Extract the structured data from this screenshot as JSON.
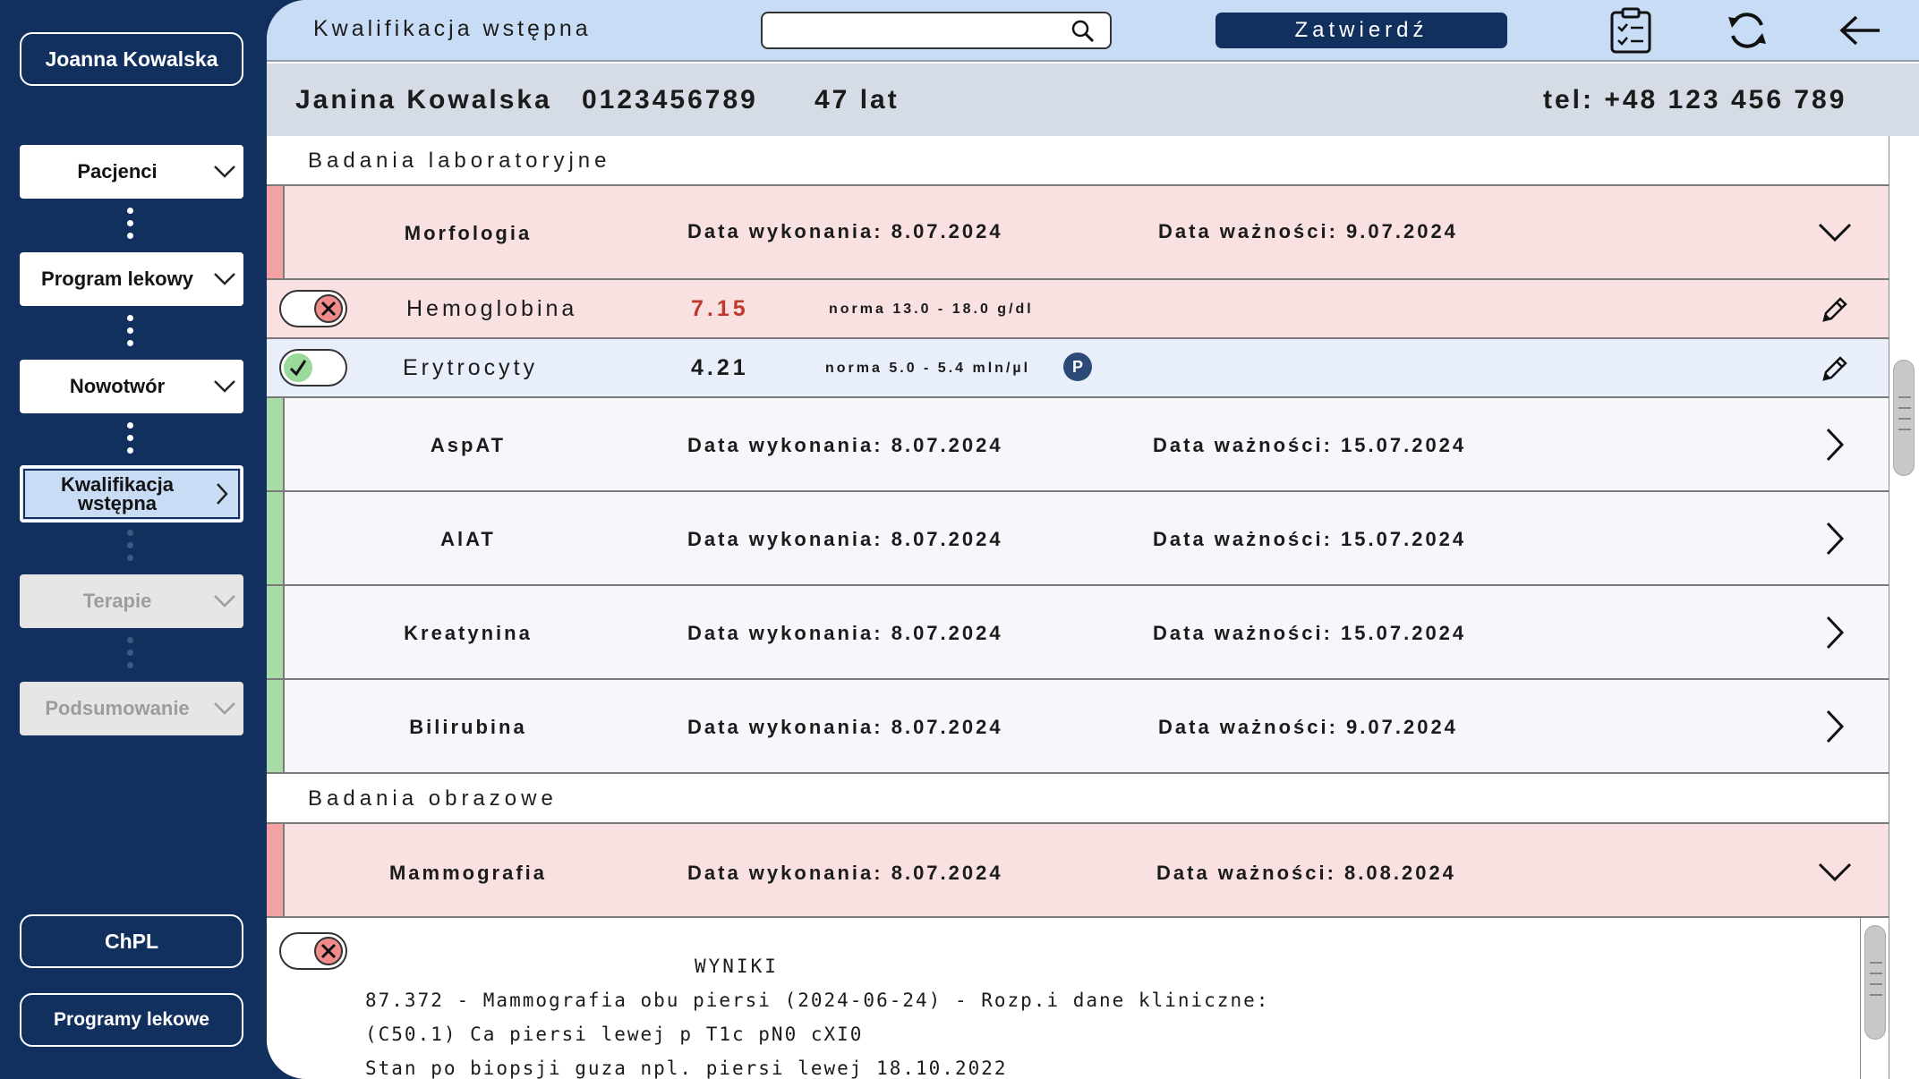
{
  "user": {
    "name": "Joanna Kowalska"
  },
  "steps": [
    {
      "label": "Pacjenci"
    },
    {
      "label": "Program lekowy"
    },
    {
      "label": "Nowotwór"
    },
    {
      "label": "Kwalifikacja wstępna"
    },
    {
      "label": "Terapie"
    },
    {
      "label": "Podsumowanie"
    }
  ],
  "bottom_links": {
    "chpl": "ChPL",
    "programs": "Programy lekowe"
  },
  "header": {
    "title": "Kwalifikacja wstępna",
    "search_value": "",
    "confirm_label": "Zatwierdź"
  },
  "patient": {
    "name": "Janina Kowalska",
    "id": "0123456789",
    "age": "47 lat",
    "phone": "tel: +48 123 456 789"
  },
  "lab": {
    "title": "Badania laboratoryjne",
    "tests": [
      {
        "name": "Morfologia",
        "performed": "Data wykonania: 8.07.2024",
        "valid": "Data ważności: 9.07.2024",
        "status": "invalid",
        "expanded": true
      },
      {
        "name": "AspAT",
        "performed": "Data wykonania: 8.07.2024",
        "valid": "Data ważności: 15.07.2024",
        "status": "valid"
      },
      {
        "name": "AlAT",
        "performed": "Data wykonania: 8.07.2024",
        "valid": "Data ważności: 15.07.2024",
        "status": "valid"
      },
      {
        "name": "Kreatynina",
        "performed": "Data wykonania: 8.07.2024",
        "valid": "Data ważności: 15.07.2024",
        "status": "valid"
      },
      {
        "name": "Bilirubina",
        "performed": "Data wykonania: 8.07.2024",
        "valid": "Data ważności: 9.07.2024",
        "status": "valid"
      }
    ],
    "subtests": [
      {
        "name": "Hemoglobina",
        "value": "7.15",
        "norm": "norma 13.0 - 18.0 g/dl",
        "ok": false
      },
      {
        "name": "Erytrocyty",
        "value": "4.21",
        "norm": "norma 5.0 - 5.4 mln/µl",
        "ok": true,
        "badge": "P"
      }
    ]
  },
  "imaging": {
    "title": "Badania obrazowe",
    "tests": [
      {
        "name": "Mammografia",
        "performed": "Data wykonania: 8.07.2024",
        "valid": "Data ważności: 8.08.2024",
        "status": "invalid",
        "expanded": true
      }
    ],
    "results_title": "WYNIKI",
    "results_lines": [
      "87.372 - Mammografia obu piersi (2024-06-24) - Rozp.i dane kliniczne:",
      "(C50.1) Ca piersi lewej p T1c pN0 cXI0",
      "Stan po biopsji guza npl. piersi lewej 18.10.2022"
    ]
  },
  "colors": {
    "sidebar": "#12305e",
    "header": "#c9dcf6",
    "invalid_row": "#f9e1e1",
    "invalid_stripe": "#f2a2a2",
    "valid_stripe": "#a7dca6",
    "error_value": "#c0392b"
  }
}
